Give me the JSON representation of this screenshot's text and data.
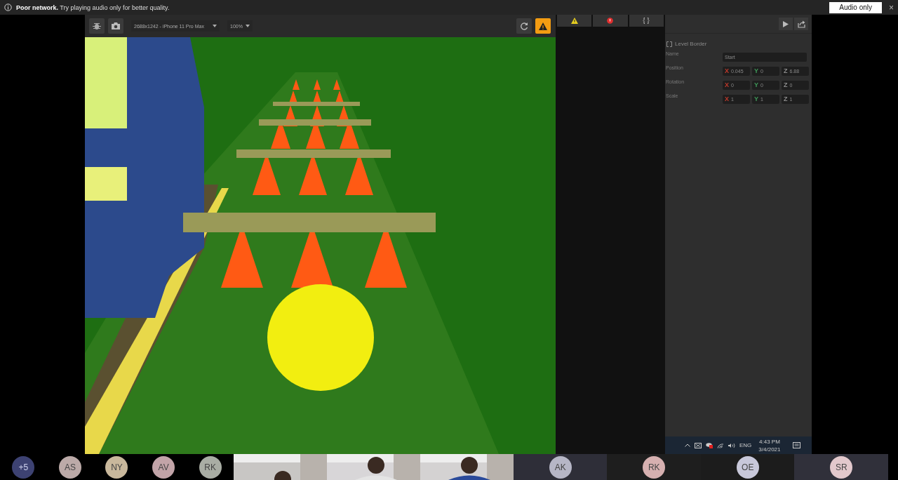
{
  "notification": {
    "title": "Poor network.",
    "message": "Try playing audio only for better quality.",
    "action": "Audio only",
    "close": "×"
  },
  "editor_toolbar": {
    "device": "2688x1242 - iPhone 11 Pro Max",
    "zoom": "100%"
  },
  "inspector": {
    "title": "Level Border",
    "fields": [
      {
        "label": "Name",
        "kind": "text",
        "value": "Start"
      },
      {
        "label": "Position",
        "kind": "vector",
        "values": [
          {
            "axis": "X",
            "value": "0.045",
            "color": "#c0392b"
          },
          {
            "axis": "Y",
            "value": "0",
            "color": "#3f9a5a"
          },
          {
            "axis": "Z",
            "value": "6.88",
            "color": "#8a8a8a"
          }
        ]
      },
      {
        "label": "Rotation",
        "kind": "vector",
        "values": [
          {
            "axis": "X",
            "value": "0",
            "color": "#c0392b"
          },
          {
            "axis": "Y",
            "value": "0",
            "color": "#3f9a5a"
          },
          {
            "axis": "Z",
            "value": "0",
            "color": "#8a8a8a"
          }
        ]
      },
      {
        "label": "Scale",
        "kind": "vector",
        "values": [
          {
            "axis": "X",
            "value": "1",
            "color": "#c0392b"
          },
          {
            "axis": "Y",
            "value": "1",
            "color": "#3f9a5a"
          },
          {
            "axis": "Z",
            "value": "1",
            "color": "#8a8a8a"
          }
        ]
      }
    ]
  },
  "taskbar": {
    "language": "ENG",
    "time": "4:43 PM",
    "date": "3/4/2021"
  },
  "participants": [
    {
      "kind": "avatar",
      "initials": "+5",
      "color": "#3d4272"
    },
    {
      "kind": "avatar",
      "initials": "AS",
      "color": "#bcaaa8"
    },
    {
      "kind": "avatar",
      "initials": "NY",
      "color": "#c9b89c"
    },
    {
      "kind": "avatar",
      "initials": "AV",
      "color": "#c2a4a8"
    },
    {
      "kind": "avatar",
      "initials": "RK",
      "color": "#a9ada4"
    },
    {
      "kind": "video"
    },
    {
      "kind": "video"
    },
    {
      "kind": "video"
    },
    {
      "kind": "tile",
      "initials": "AK",
      "color": "#b6b6c6"
    },
    {
      "kind": "tile",
      "initials": "RK",
      "color": "#d6b0b0"
    },
    {
      "kind": "tile",
      "initials": "OE",
      "color": "#c8c8da"
    },
    {
      "kind": "tile",
      "initials": "SR",
      "color": "#e2c8cc"
    }
  ]
}
